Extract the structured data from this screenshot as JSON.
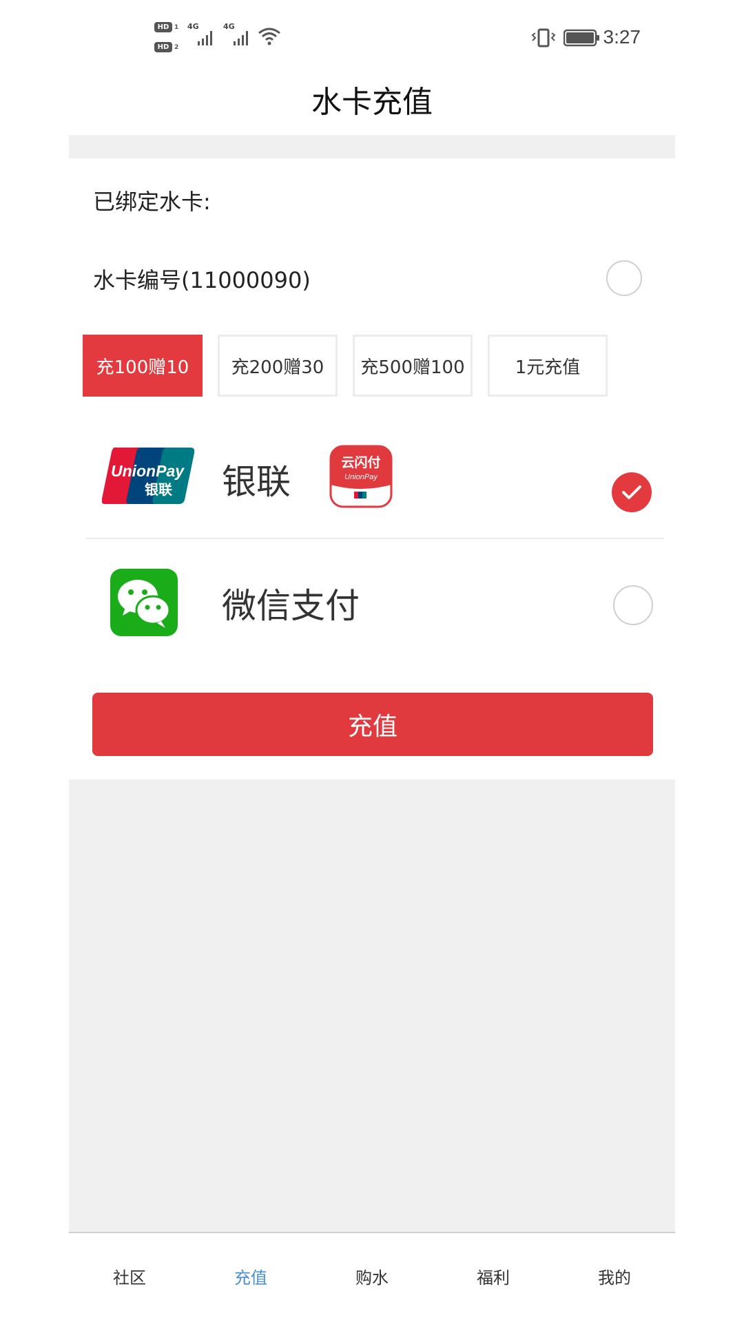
{
  "status_bar": {
    "hd1": "HD",
    "sim1": "1",
    "hd2": "HD",
    "sim2": "2",
    "net1": "4G",
    "net2": "4G",
    "time": "3:27"
  },
  "header": {
    "title": "水卡充值"
  },
  "card": {
    "bound_label": "已绑定水卡:",
    "card_label": "水卡编号(11000090)"
  },
  "amount_options": [
    {
      "label": "充100赠10",
      "selected": true
    },
    {
      "label": "充200赠30",
      "selected": false
    },
    {
      "label": "充500赠100",
      "selected": false
    },
    {
      "label": "1元充值",
      "selected": false
    }
  ],
  "payment": {
    "unionpay_logo_text": "UnionPay",
    "unionpay_logo_cn": "银联",
    "unionpay_label": "银联",
    "quickpass_cn": "云闪付",
    "quickpass_en": "UnionPay",
    "wechat_label": "微信支付"
  },
  "submit_label": "充值",
  "bottom_nav": [
    {
      "label": "社区",
      "active": false
    },
    {
      "label": "充值",
      "active": true
    },
    {
      "label": "购水",
      "active": false
    },
    {
      "label": "福利",
      "active": false
    },
    {
      "label": "我的",
      "active": false
    }
  ],
  "colors": {
    "accent": "#e23a3f",
    "nav_active": "#4a8fd6",
    "background_gray": "#f0f0f0",
    "wechat_green": "#1aad19"
  },
  "icons": [
    "vibrate-icon",
    "battery-icon",
    "signal-icon",
    "wifi-icon",
    "check-icon",
    "wechat-icon",
    "unionpay-icon",
    "quickpass-icon"
  ]
}
